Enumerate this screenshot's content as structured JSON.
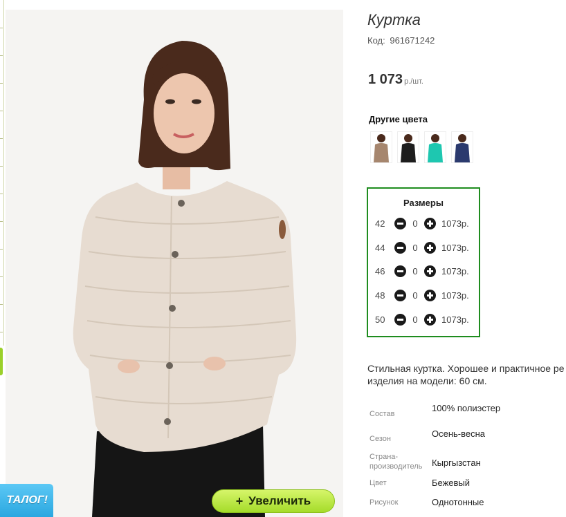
{
  "product": {
    "title": "Куртка",
    "code_label": "Код:",
    "code_value": "961671242",
    "price": "1 073",
    "price_unit": "р./шт."
  },
  "colors": {
    "title": "Другие цвета",
    "swatches": [
      {
        "name": "beige-brown",
        "hex": "#a6866e"
      },
      {
        "name": "black",
        "hex": "#1d1d1d"
      },
      {
        "name": "turquoise",
        "hex": "#1ec7b0"
      },
      {
        "name": "navy",
        "hex": "#2b3a6e"
      }
    ]
  },
  "sizes": {
    "title": "Размеры",
    "rows": [
      {
        "size": "42",
        "qty": "0",
        "price": "1073р."
      },
      {
        "size": "44",
        "qty": "0",
        "price": "1073р."
      },
      {
        "size": "46",
        "qty": "0",
        "price": "1073р."
      },
      {
        "size": "48",
        "qty": "0",
        "price": "1073р."
      },
      {
        "size": "50",
        "qty": "0",
        "price": "1073р."
      }
    ]
  },
  "description": {
    "line1": "Стильная куртка. Хорошее и практичное ре",
    "line2": "изделия на модели: 60 см."
  },
  "properties": [
    {
      "label": "Состав",
      "value": "100% полиэстер"
    },
    {
      "label": "Сезон",
      "value": "Осень-весна"
    },
    {
      "label": "Страна-производитель",
      "value": "Кыргызстан"
    },
    {
      "label": "Цвет",
      "value": "Бежевый"
    },
    {
      "label": "Рисунок",
      "value": "Однотонные"
    }
  ],
  "buttons": {
    "zoom_label": "Увеличить",
    "zoom_icon": "+",
    "catalog_label": "ТАЛОГ!"
  },
  "colors_theme": {
    "sizes_border": "#1e8c1e",
    "zoom_button": "#b8e63c",
    "catalog_badge": "#2aa7e0"
  }
}
